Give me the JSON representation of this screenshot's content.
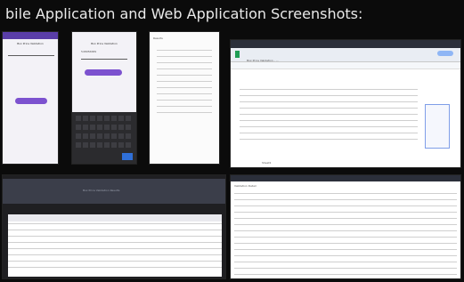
{
  "title": "bile Application and Web Application Screenshots:",
  "phones": [
    {
      "screen_title": "Box Price Validation"
    },
    {
      "screen_title": "Box Price Validation",
      "field_value": "548956689",
      "keyboard_key": "Go"
    }
  ],
  "list_app": {
    "label": "Results"
  },
  "sheet": {
    "file_name": "Box Price Validation - ...",
    "tab_label": "Sheet1"
  },
  "web_table": {
    "header_title": "Box Price Validation Results"
  },
  "web_detail": {
    "title": "Validation Detail"
  },
  "colors": {
    "accent": "#7c52cf",
    "appbar": "#5a3ea8",
    "sheets_green": "#1f9d55",
    "background": "#0b0b0b"
  }
}
